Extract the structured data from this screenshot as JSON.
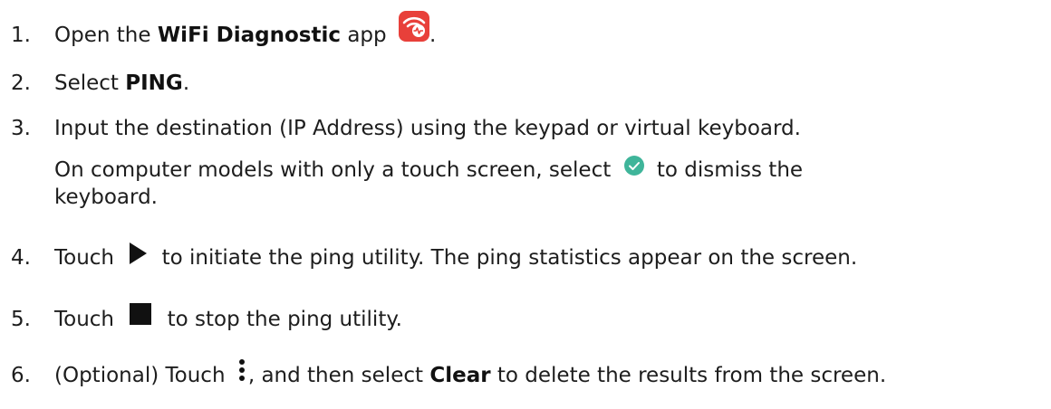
{
  "steps": [
    {
      "number": "1.",
      "pre": "Open the ",
      "bold": "WiFi Diagnostic",
      "post": " app",
      "end": ".",
      "icon": "wifi-diagnostic-app-icon"
    },
    {
      "number": "2.",
      "pre": "Select ",
      "bold": "PING",
      "post": "."
    },
    {
      "number": "3.",
      "text": "Input the destination (IP Address) using the keypad or virtual keyboard.",
      "note_pre": "On computer models with only a touch screen, select",
      "note_post": "to dismiss the",
      "note_line2": "keyboard.",
      "icon": "checkmark-circle-icon"
    },
    {
      "number": "4.",
      "pre": "Touch",
      "post": "to initiate the ping utility. The ping statistics appear on the screen.",
      "icon": "play-icon"
    },
    {
      "number": "5.",
      "pre": "Touch",
      "post": "to stop the ping utility.",
      "icon": "stop-icon"
    },
    {
      "number": "6.",
      "pre": "(Optional) Touch",
      "mid": ", and then select ",
      "bold": "Clear",
      "post": " to delete the results from the screen.",
      "icon": "more-vertical-icon"
    }
  ],
  "colors": {
    "app_icon_bg": "#e8403a",
    "check_circle": "#3fb59a",
    "text": "#1d1d1d"
  }
}
